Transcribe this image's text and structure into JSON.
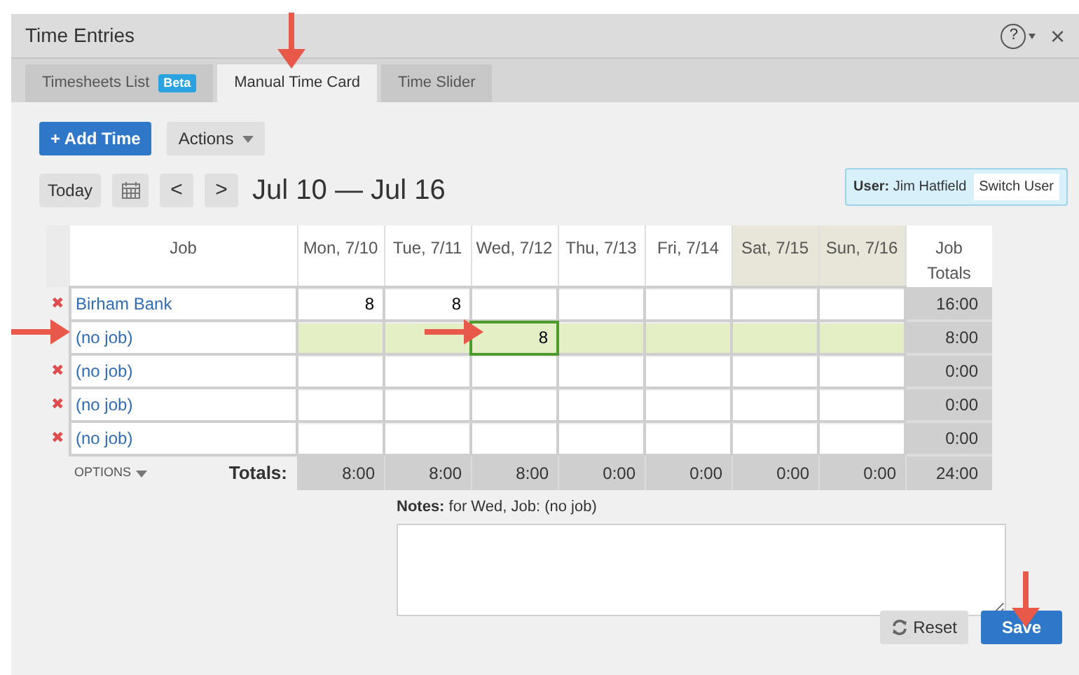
{
  "window": {
    "title": "Time Entries",
    "help": "?",
    "close": "×"
  },
  "tabs": [
    {
      "label": "Timesheets List",
      "badge": "Beta",
      "selected": false
    },
    {
      "label": "Manual Time Card",
      "selected": true
    },
    {
      "label": "Time Slider",
      "selected": false
    }
  ],
  "toolbar": {
    "add": "+ Add Time",
    "actions": "Actions",
    "today": "Today",
    "prev": "<",
    "next": ">",
    "range": "Jul 10 — Jul 16"
  },
  "user": {
    "label": "User:",
    "name": "Jim Hatfield",
    "switch": "Switch User"
  },
  "table": {
    "job_column": "Job",
    "columns": [
      {
        "label": "Mon, 7/10",
        "weekend": false
      },
      {
        "label": "Tue, 7/11",
        "weekend": false
      },
      {
        "label": "Wed, 7/12",
        "weekend": false
      },
      {
        "label": "Thu, 7/13",
        "weekend": false
      },
      {
        "label": "Fri, 7/14",
        "weekend": false
      },
      {
        "label": "Sat, 7/15",
        "weekend": true
      },
      {
        "label": "Sun, 7/16",
        "weekend": true
      }
    ],
    "total_column": "Job Totals",
    "rows": [
      {
        "job": "Birham Bank",
        "delete": "✖",
        "selected": false,
        "cells": [
          {
            "value": "8",
            "focused": false
          },
          {
            "value": "8",
            "focused": false
          },
          {
            "focused": false
          },
          {
            "focused": false
          },
          {
            "focused": false
          },
          {
            "focused": false
          },
          {
            "focused": false
          }
        ],
        "total": "16:00"
      },
      {
        "job": "(no job)",
        "selected": true,
        "cells": [
          {
            "focused": false
          },
          {
            "focused": false
          },
          {
            "value": "8",
            "focused": true
          },
          {
            "focused": false
          },
          {
            "focused": false
          },
          {
            "focused": false
          },
          {
            "focused": false
          }
        ],
        "total": "8:00"
      },
      {
        "job": "(no job)",
        "delete": "✖",
        "selected": false,
        "cells": [
          {
            "focused": false
          },
          {
            "focused": false
          },
          {
            "focused": false
          },
          {
            "focused": false
          },
          {
            "focused": false
          },
          {
            "focused": false
          },
          {
            "focused": false
          }
        ],
        "total": "0:00"
      },
      {
        "job": "(no job)",
        "delete": "✖",
        "selected": false,
        "cells": [
          {
            "focused": false
          },
          {
            "focused": false
          },
          {
            "focused": false
          },
          {
            "focused": false
          },
          {
            "focused": false
          },
          {
            "focused": false
          },
          {
            "focused": false
          }
        ],
        "total": "0:00"
      },
      {
        "job": "(no job)",
        "delete": "✖",
        "selected": false,
        "cells": [
          {
            "focused": false
          },
          {
            "focused": false
          },
          {
            "focused": false
          },
          {
            "focused": false
          },
          {
            "focused": false
          },
          {
            "focused": false
          },
          {
            "focused": false
          }
        ],
        "total": "0:00"
      }
    ],
    "options": "OPTIONS",
    "totals_label": "Totals:",
    "totals": [
      "8:00",
      "8:00",
      "8:00",
      "0:00",
      "0:00",
      "0:00",
      "0:00"
    ],
    "grand_total": "24:00"
  },
  "notes": {
    "label": "**Notes:** for Wed, Job: (no job)"
  },
  "buttons": {
    "reset": "Reset",
    "save": "Save"
  }
}
